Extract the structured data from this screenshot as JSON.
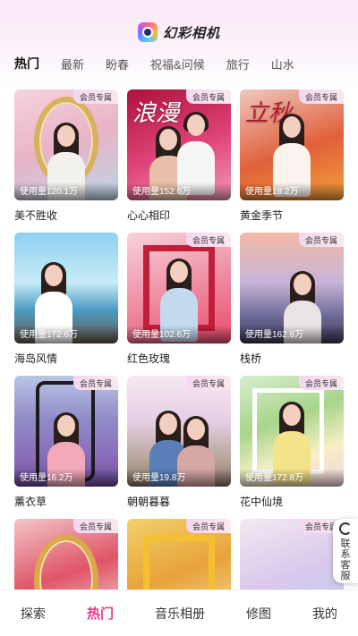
{
  "app": {
    "title": "幻彩相机"
  },
  "tabs": [
    "热门",
    "最新",
    "盼春",
    "祝福&问候",
    "旅行",
    "山水"
  ],
  "badge_label": "会员专属",
  "usage_label": "使用量",
  "templates": [
    {
      "title": "美不胜收",
      "usage": "120.1万",
      "badge": true
    },
    {
      "title": "心心相印",
      "usage": "152.6万",
      "badge": true,
      "overlay_text": "浪漫"
    },
    {
      "title": "黄金季节",
      "usage": "18.2万",
      "badge": true,
      "overlay_text": "立秋"
    },
    {
      "title": "海岛风情",
      "usage": "172.6万",
      "badge": false
    },
    {
      "title": "红色玫瑰",
      "usage": "102.6万",
      "badge": true
    },
    {
      "title": "栈桥",
      "usage": "162.8万",
      "badge": true
    },
    {
      "title": "薰衣草",
      "usage": "16.2万",
      "badge": true
    },
    {
      "title": "朝朝暮暮",
      "usage": "19.8万",
      "badge": true
    },
    {
      "title": "花中仙境",
      "usage": "172.8万",
      "badge": true
    },
    {
      "title": "",
      "usage": "",
      "badge": true
    },
    {
      "title": "",
      "usage": "",
      "badge": true
    },
    {
      "title": "",
      "usage": "",
      "badge": true
    }
  ],
  "customer_service": "联系客服",
  "bottom_nav": [
    "探索",
    "热门",
    "音乐相册",
    "修图",
    "我的"
  ],
  "colors": {
    "accent": "#e63a8a"
  }
}
